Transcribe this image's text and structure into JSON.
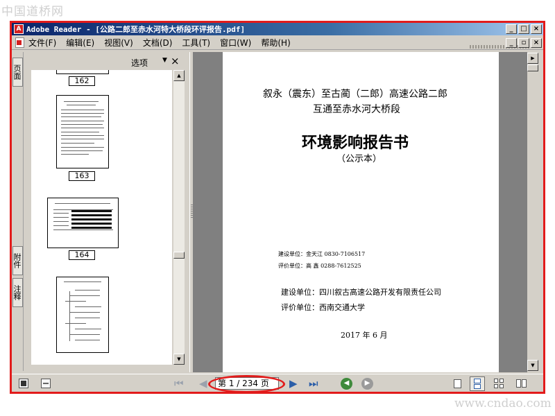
{
  "watermark_top": "中国道桥网",
  "watermark_bottom": "www.cndao.com",
  "window": {
    "title": "Adobe Reader - [公路二郎至赤水河特大桥段环评报告.pdf]",
    "app_icon_glyph": "A"
  },
  "menu": [
    "文件(F)",
    "编辑(E)",
    "视图(V)",
    "文档(D)",
    "工具(T)",
    "窗口(W)",
    "帮助(H)"
  ],
  "side_tabs": [
    "页面",
    "附件",
    "注释"
  ],
  "thumb_panel": {
    "options_label": "选项",
    "close_glyph": "×",
    "pages": [
      "162",
      "163",
      "164"
    ]
  },
  "document": {
    "title_line1": "叙永（震东）至古蔺（二郎）高速公路二郎",
    "title_line2": "互通至赤水河大桥段",
    "main_title": "环境影响报告书",
    "subtitle": "（公示本）",
    "small_build_unit": "建设单位：金天江    0830-7106517",
    "small_eval_unit": "评价单位：高  鑫    0288-7612525",
    "build_unit": "建设单位：四川叙古高速公路开发有限责任公司",
    "eval_unit": "评价单位：西南交通大学",
    "date": "2017 年 6 月"
  },
  "navigation": {
    "page_indicator": "第 1 / 234 页",
    "current_page": 1,
    "total_pages": 234
  },
  "colors": {
    "frame_border": "#e21b1b",
    "titlebar": "#0a246a",
    "highlight_ellipse": "#e21b1b",
    "nav_arrow": "#2b5ea8",
    "back_circle": "#3f8a3c",
    "forward_circle": "#9a9a9a"
  },
  "icons": [
    "pdf-app-icon",
    "document-icon",
    "minimize-icon",
    "maximize-icon",
    "close-icon",
    "first-page-icon",
    "previous-page-icon",
    "next-page-icon",
    "last-page-icon",
    "go-back-icon",
    "go-forward-icon",
    "single-page-icon",
    "continuous-icon",
    "continuous-facing-icon",
    "facing-icon"
  ]
}
